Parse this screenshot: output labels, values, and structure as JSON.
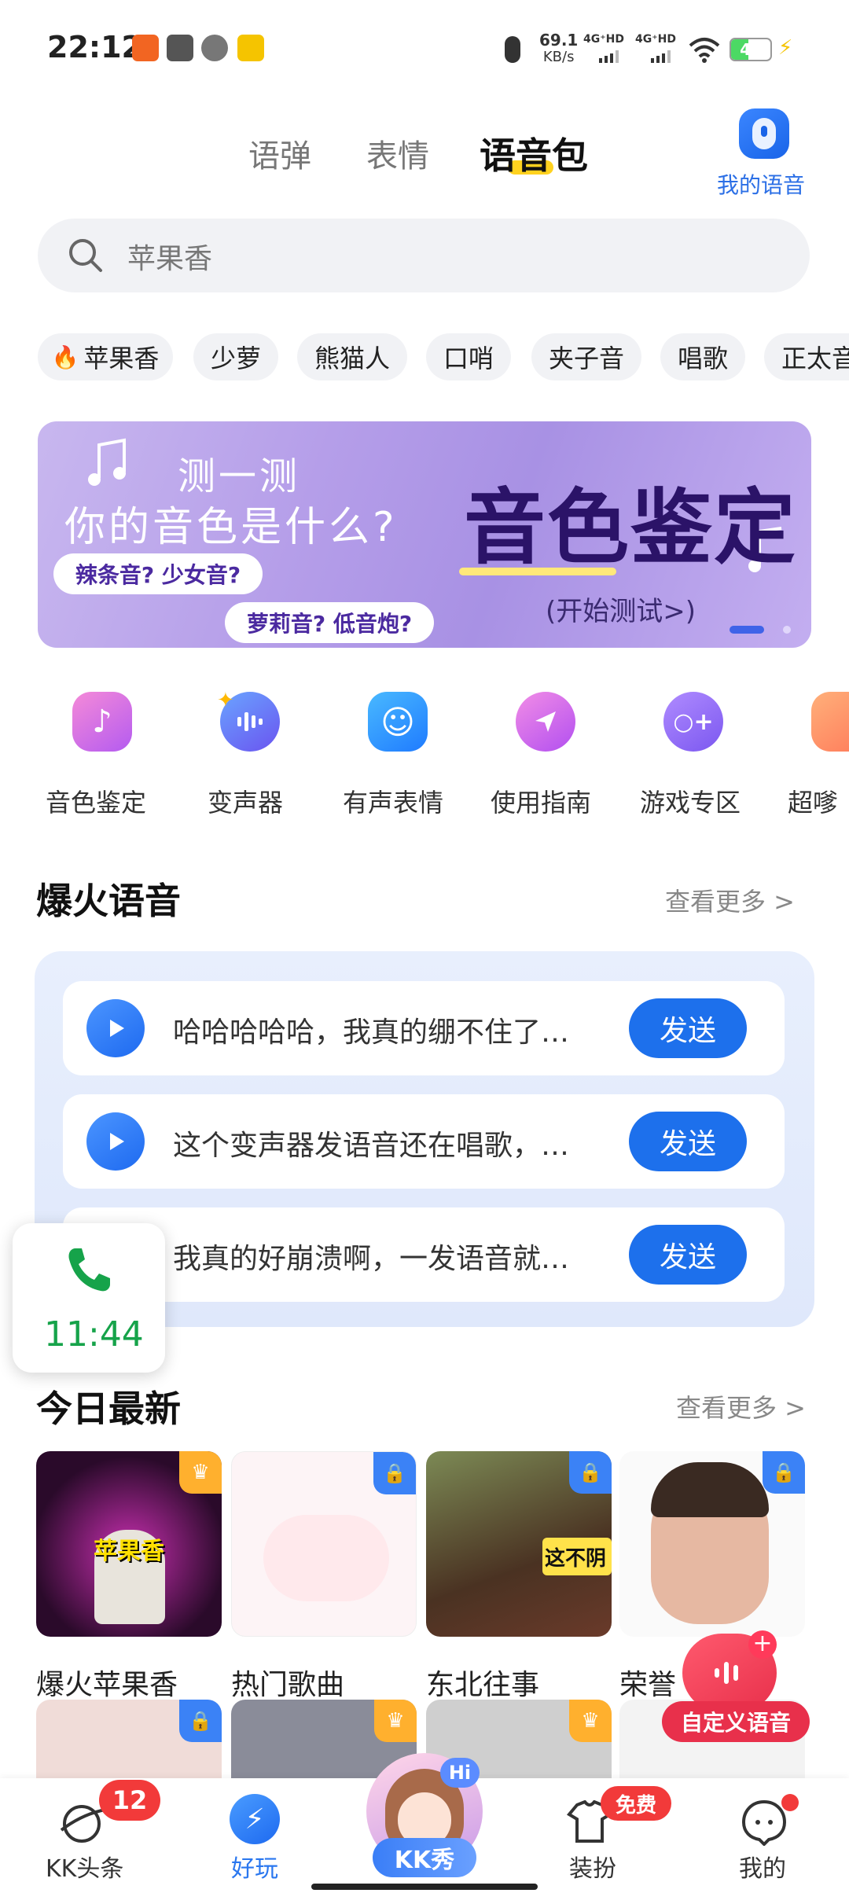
{
  "status_bar": {
    "time": "22:12",
    "net_speed": "69.1",
    "net_unit": "KB/s",
    "sim1": "4G⁺HD",
    "sim2": "4G⁺HD",
    "battery": "41"
  },
  "top_tabs": [
    {
      "label": "语弹",
      "active": false
    },
    {
      "label": "表情",
      "active": false
    },
    {
      "label": "语音包",
      "active": true
    }
  ],
  "my_voice": {
    "label": "我的语音"
  },
  "search": {
    "value": "苹果香"
  },
  "chips": [
    "苹果香",
    "少萝",
    "熊猫人",
    "口哨",
    "夹子音",
    "唱歌",
    "正太音"
  ],
  "banner": {
    "line1": "测一测",
    "line2": "你的音色是什么?",
    "pill1": "辣条音? 少女音?",
    "pill2": "萝莉音? 低音炮?",
    "big": "音色鉴定",
    "cta": "(开始测试>)"
  },
  "quick_icons": [
    "音色鉴定",
    "变声器",
    "有声表情",
    "使用指南",
    "游戏专区",
    "超嗲"
  ],
  "hot_voice": {
    "title": "爆火语音",
    "see_more": "查看更多 >",
    "items": [
      {
        "text": "哈哈哈哈哈，我真的绷不住了…",
        "button": "发送"
      },
      {
        "text": "这个变声器发语音还在唱歌，…",
        "button": "发送"
      },
      {
        "text": "我真的好崩溃啊，一发语音就…",
        "button": "发送"
      }
    ]
  },
  "call_widget": {
    "time": "11:44"
  },
  "today_new": {
    "title": "今日最新",
    "see_more": "查看更多 >",
    "tiles": [
      {
        "label": "爆火苹果香",
        "caption": "苹果香"
      },
      {
        "label": "热门歌曲",
        "caption": ""
      },
      {
        "label": "东北往事",
        "caption": "这不阴"
      },
      {
        "label": "荣誉",
        "caption": ""
      }
    ]
  },
  "custom_voice": {
    "label": "自定义语音"
  },
  "bottom_nav": [
    {
      "label": "KK头条",
      "badge": "12",
      "active": false
    },
    {
      "label": "好玩",
      "active": true
    },
    {
      "label": "KK秀",
      "badge": "Hi",
      "active": false
    },
    {
      "label": "装扮",
      "badge": "免费",
      "active": false
    },
    {
      "label": "我的",
      "active": false
    }
  ],
  "colors": {
    "accent": "#1d70ec",
    "badge": "#f23a3a",
    "call_green": "#16a34a",
    "tab_underline": "#ffd21f"
  }
}
